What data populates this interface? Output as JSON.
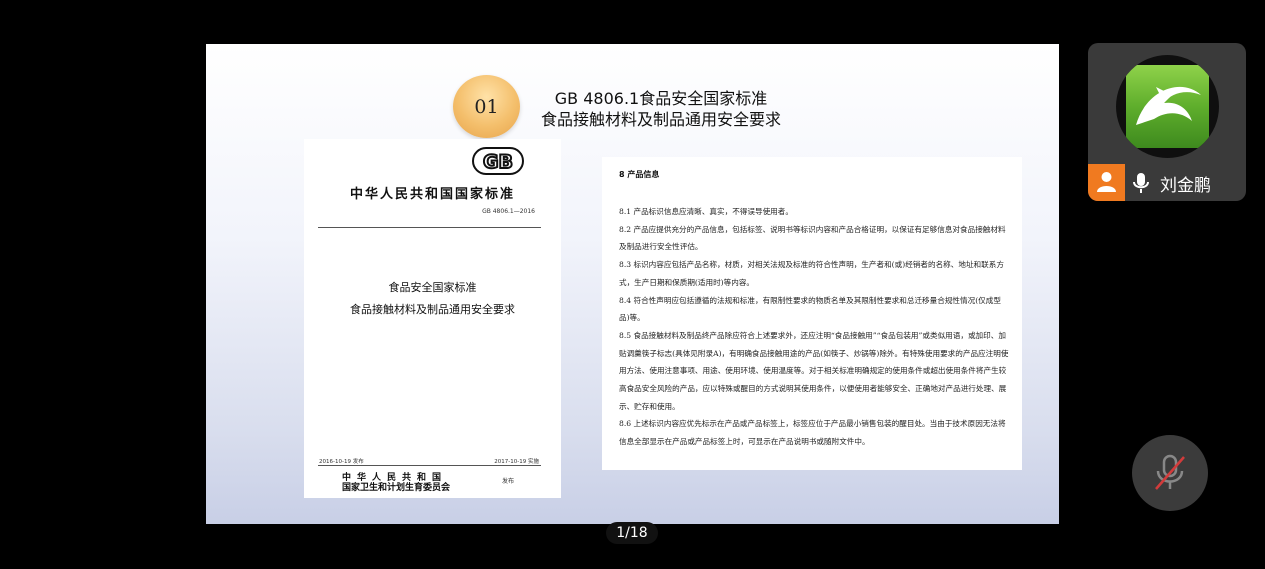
{
  "slide": {
    "badge": "01",
    "title_line1": "GB 4806.1食品安全国家标准",
    "title_line2": "食品接触材料及制品通用安全要求",
    "doc_left": {
      "logo_text": "GB",
      "country": "中华人民共和国国家标准",
      "std_no": "GB 4806.1—2016",
      "title1": "食品安全国家标准",
      "title2": "食品接触材料及制品通用安全要求",
      "date_pub": "2016-10-19 发布",
      "date_impl": "2017-10-19 实施",
      "issuer1": "中华人民共和国",
      "issuer2": "国家卫生和计划生育委员会",
      "publish": "发布"
    },
    "doc_right": {
      "section": "8  产品信息",
      "paras": [
        "8.1   产品标识信息应清晰、真实，不得误导使用者。",
        "8.2   产品应提供充分的产品信息，包括标签、说明书等标识内容和产品合格证明，以保证有足够信息对食品接触材料及制品进行安全性评估。",
        "8.3   标识内容应包括产品名称，材质，对相关法规及标准的符合性声明，生产者和(或)经销者的名称、地址和联系方式，生产日期和保质期(适用时)等内容。",
        "8.4   符合性声明应包括遵循的法规和标准，有限制性要求的物质名单及其限制性要求和总迁移量合规性情况(仅成型品)等。",
        "8.5   食品接触材料及制品终产品除应符合上述要求外，还应注明“食品接触用”“食品包装用”或类似用语，或加印、加贴调羹筷子标志(具体见附录A)，有明确食品接触用途的产品(如筷子、炒锅等)除外。有特殊使用要求的产品应注明使用方法、使用注意事项、用途、使用环境、使用温度等。对于相关标准明确规定的使用条件或超出使用条件将产生较高食品安全风险的产品，应以特殊或醒目的方式说明其使用条件，以便使用者能够安全、正确地对产品进行处理、展示、贮存和使用。",
        "8.6   上述标识内容应优先标示在产品或产品标签上，标签应位于产品最小销售包装的醒目处。当由于技术原因无法将信息全部显示在产品或产品标签上时，可显示在产品说明书或随附文件中。"
      ]
    }
  },
  "page_indicator": "1/18",
  "participant": {
    "name": "刘金鹏",
    "avatar_icon": "dolphin-browser-logo",
    "role_icon": "host-icon",
    "mic_icon": "microphone-icon",
    "accent": "#f07a20"
  },
  "controls": {
    "mute_icon": "microphone-muted-icon"
  }
}
